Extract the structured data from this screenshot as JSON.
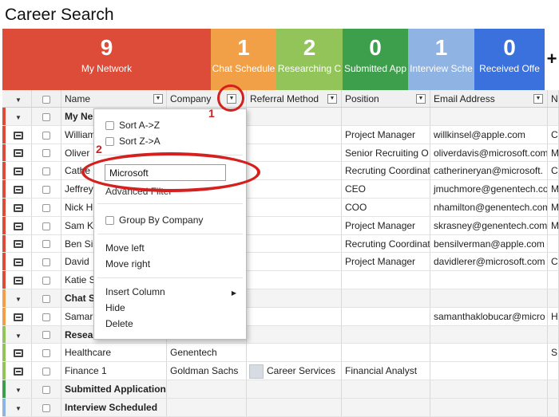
{
  "app": {
    "title": "Career Search"
  },
  "stages": [
    {
      "count": "9",
      "label": "My Network",
      "color": "#dd4b39"
    },
    {
      "count": "1",
      "label": "Chat Schedule",
      "color": "#f2a047"
    },
    {
      "count": "2",
      "label": "Researching C",
      "color": "#93c45a"
    },
    {
      "count": "0",
      "label": "Submitted App",
      "color": "#3d9e4b"
    },
    {
      "count": "1",
      "label": "Interview Sche",
      "color": "#8fb3e2"
    },
    {
      "count": "0",
      "label": "Received Offe",
      "color": "#3a71dc"
    }
  ],
  "add_stage_label": "+",
  "columns": {
    "name": "Name",
    "company": "Company",
    "referral": "Referral Method",
    "position": "Position",
    "email": "Email Address",
    "more": "N"
  },
  "rows": [
    {
      "type": "group",
      "name": "My Ne",
      "strip": "#dd4b39"
    },
    {
      "type": "item",
      "name": "William",
      "company": "",
      "referral": "",
      "position": "Project Manager",
      "email": "willkinsel@apple.com",
      "more": "C",
      "strip": "#dd4b39"
    },
    {
      "type": "item",
      "name": "Oliver",
      "company": "",
      "referral": "",
      "position": "Senior Recruiting O",
      "email": "oliverdavis@microsoft.com",
      "more": "M",
      "strip": "#dd4b39"
    },
    {
      "type": "item",
      "name": "Cathe",
      "company": "",
      "referral": "",
      "position": "Recruting Coordinat",
      "email": "catherineryan@microsoft.",
      "more": "C",
      "strip": "#dd4b39"
    },
    {
      "type": "item",
      "name": "Jeffrey",
      "company": "",
      "referral": "",
      "position": "CEO",
      "email": "jmuchmore@genentech.co",
      "more": "M",
      "strip": "#dd4b39"
    },
    {
      "type": "item",
      "name": "Nick H",
      "company": "",
      "referral": "",
      "position": "COO",
      "email": "nhamilton@genentech.com",
      "more": "M",
      "strip": "#dd4b39"
    },
    {
      "type": "item",
      "name": "Sam K",
      "company": "",
      "referral": "",
      "position": "Project Manager",
      "email": "skrasney@genentech.com",
      "more": "M",
      "strip": "#dd4b39"
    },
    {
      "type": "item",
      "name": "Ben Si",
      "company": "",
      "referral": "",
      "position": "Recruting Coordinat",
      "email": "bensilverman@apple.com",
      "more": "",
      "strip": "#dd4b39"
    },
    {
      "type": "item",
      "name": "David",
      "company": "",
      "referral": "",
      "position": "Project Manager",
      "email": "davidlerer@microsoft.com",
      "more": "C",
      "strip": "#dd4b39"
    },
    {
      "type": "item",
      "name": "Katie S",
      "company": "",
      "referral": "",
      "position": "",
      "email": "",
      "more": "",
      "strip": "#dd4b39"
    },
    {
      "type": "group",
      "name": "Chat S",
      "strip": "#f2a047"
    },
    {
      "type": "item",
      "name": "Samar",
      "company": "",
      "referral": "",
      "position": "",
      "email": "samanthaklobucar@micro",
      "more": "H",
      "strip": "#f2a047"
    },
    {
      "type": "group",
      "name": "Resea",
      "strip": "#93c45a"
    },
    {
      "type": "item",
      "name": "Healthcare",
      "company": "Genentech",
      "referral": "",
      "position": "",
      "email": "",
      "more": "S",
      "strip": "#93c45a"
    },
    {
      "type": "item",
      "name": "Finance 1",
      "company": "Goldman Sachs",
      "referral": "Career Services",
      "position": "Financial Analyst",
      "email": "",
      "more": "",
      "strip": "#93c45a",
      "has_avatar": true
    },
    {
      "type": "group",
      "name": "Submitted Application",
      "strip": "#3d9e4b"
    },
    {
      "type": "group",
      "name": "Interview Scheduled",
      "strip": "#8fb3e2"
    }
  ],
  "column_menu": {
    "sort_az": "Sort A->Z",
    "sort_za": "Sort Z->A",
    "filter_value": "Microsoft",
    "advanced_filter": "Advanced Filter",
    "group_by": "Group By Company",
    "move_left": "Move left",
    "move_right": "Move right",
    "insert_column": "Insert Column",
    "hide": "Hide",
    "delete": "Delete"
  },
  "annotations": {
    "step1": "1",
    "step2": "2",
    "color": "#d4201f"
  }
}
